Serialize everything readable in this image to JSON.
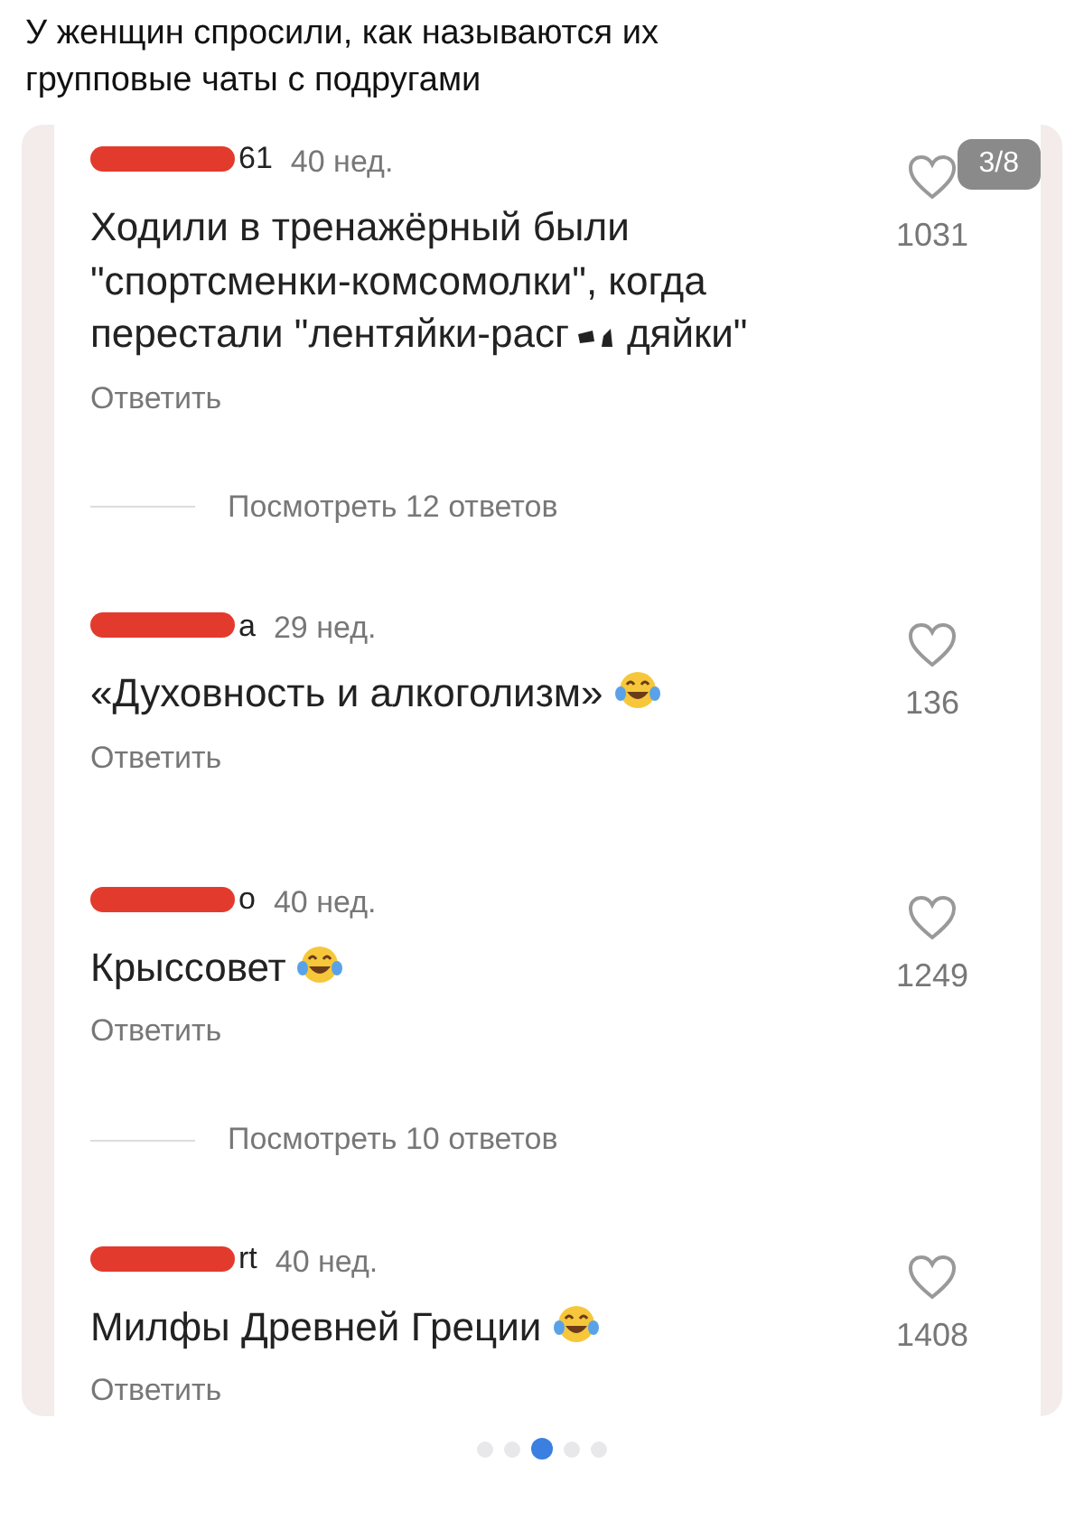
{
  "caption": "У женщин спросили, как называются их групповые чаты с подругами",
  "slide_counter": "3/8",
  "comments": [
    {
      "username": "61",
      "time": "40 нед.",
      "text": "Ходили в тренажёрный были \"спортсменки-комсомолки\", когда перестали \"лентяйки-расг",
      "text_after": "дяйки\"",
      "emoji": false,
      "reply": "Ответить",
      "likes": "1031",
      "view_replies": "Посмотреть 12 ответов"
    },
    {
      "username": "a",
      "time": "29 нед.",
      "text": "«Духовность и алкоголизм»",
      "emoji": true,
      "reply": "Ответить",
      "likes": "136"
    },
    {
      "username": "o",
      "time": "40 нед.",
      "text": "Крыссовет",
      "emoji": true,
      "reply": "Ответить",
      "likes": "1249",
      "view_replies": "Посмотреть 10 ответов"
    },
    {
      "username": "rt",
      "time": "40 нед.",
      "text": "Милфы Древней Греции",
      "emoji": true,
      "reply": "Ответить",
      "likes": "1408"
    }
  ],
  "pager": [
    {
      "selected": false
    },
    {
      "selected": false
    },
    {
      "selected": true
    },
    {
      "selected": false
    },
    {
      "selected": false
    }
  ]
}
